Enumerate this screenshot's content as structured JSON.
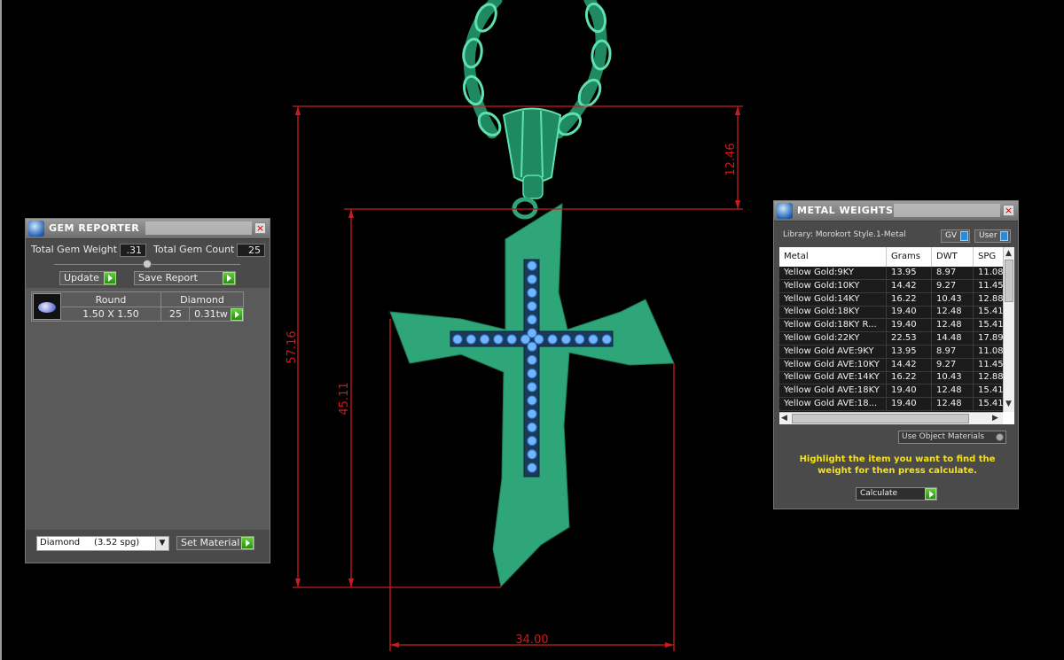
{
  "gem_reporter": {
    "title": "GEM REPORTER",
    "close_label": "×",
    "total_gem_weight_label": "Total Gem Weight",
    "total_gem_weight_value": ".31",
    "total_gem_count_label": "Total Gem Count",
    "total_gem_count_value": "25",
    "update_label": "Update",
    "save_report_label": "Save Report",
    "table": {
      "headers": [
        "Round",
        "Diamond"
      ],
      "size": "1.50 X 1.50",
      "count": "25",
      "weight": "0.31tw"
    },
    "material_select": "Diamond     (3.52 spg)",
    "set_material_label": "Set Material"
  },
  "metal_weights": {
    "title": "METAL WEIGHTS",
    "close_label": "×",
    "library_label": "Library: Morokort Style.1-Metal",
    "gv_label": "GV",
    "user_label": "User",
    "columns": [
      "Metal",
      "Grams",
      "DWT",
      "SPG"
    ],
    "rows": [
      [
        "Yellow Gold:9KY",
        "13.95",
        "8.97",
        "11.08"
      ],
      [
        "Yellow Gold:10KY",
        "14.42",
        "9.27",
        "11.45"
      ],
      [
        "Yellow Gold:14KY",
        "16.22",
        "10.43",
        "12.88"
      ],
      [
        "Yellow Gold:18KY",
        "19.40",
        "12.48",
        "15.41"
      ],
      [
        "Yellow Gold:18KY R...",
        "19.40",
        "12.48",
        "15.41"
      ],
      [
        "Yellow Gold:22KY",
        "22.53",
        "14.48",
        "17.89"
      ],
      [
        "Yellow Gold AVE:9KY",
        "13.95",
        "8.97",
        "11.08"
      ],
      [
        "Yellow Gold AVE:10KY",
        "14.42",
        "9.27",
        "11.45"
      ],
      [
        "Yellow Gold AVE:14KY",
        "16.22",
        "10.43",
        "12.88"
      ],
      [
        "Yellow Gold AVE:18KY",
        "19.40",
        "12.48",
        "15.41"
      ],
      [
        "Yellow Gold AVE:18...",
        "19.40",
        "12.48",
        "15.41"
      ]
    ],
    "use_object_materials_label": "Use Object Materials",
    "hint": "Highlight the item you want to find the weight for then press calculate.",
    "calculate_label": "Calculate"
  },
  "dimensions": {
    "bail_height": "12.46",
    "total_height": "57.16",
    "cross_height": "45.11",
    "cross_width": "34.00"
  },
  "colors": {
    "model_green": "#2fa57a",
    "gem_blue": "#6fb5ff",
    "dimension_red": "#d01a1a",
    "hint_yellow": "#f5e11a"
  }
}
